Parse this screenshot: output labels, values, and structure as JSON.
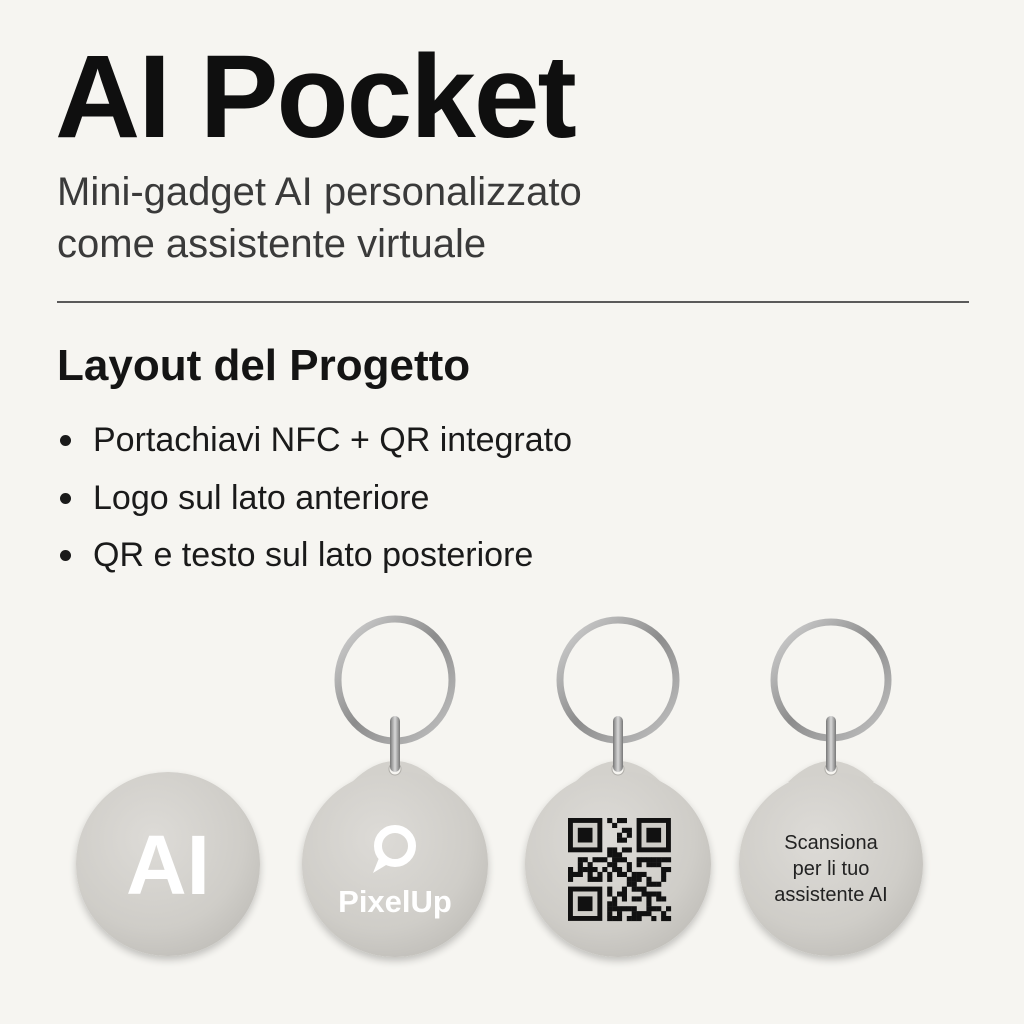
{
  "header": {
    "title": "AI Pocket",
    "subtitle_line1": "Mini-gadget AI personalizzato",
    "subtitle_line2": "come assistente virtuale"
  },
  "section": {
    "heading": "Layout del Progetto",
    "bullets": [
      "Portachiavi NFC + QR integrato",
      "Logo sul lato anteriore",
      "QR e testo sul lato posteriore"
    ]
  },
  "tags": {
    "tag1_text": "AI",
    "tag2_logo_text": "PixelUp",
    "tag4_line1": "Scansiona",
    "tag4_line2": "per li tuo",
    "tag4_line3": "assistente AI"
  },
  "colors": {
    "background": "#f6f5f1",
    "tag_body": "#cfcdc8",
    "tag_text": "#ffffff",
    "ring": "#9a9a9a"
  },
  "icons": {
    "tag2_logo": "pixelup-p-icon",
    "tag3_code": "qr-code-icon"
  }
}
